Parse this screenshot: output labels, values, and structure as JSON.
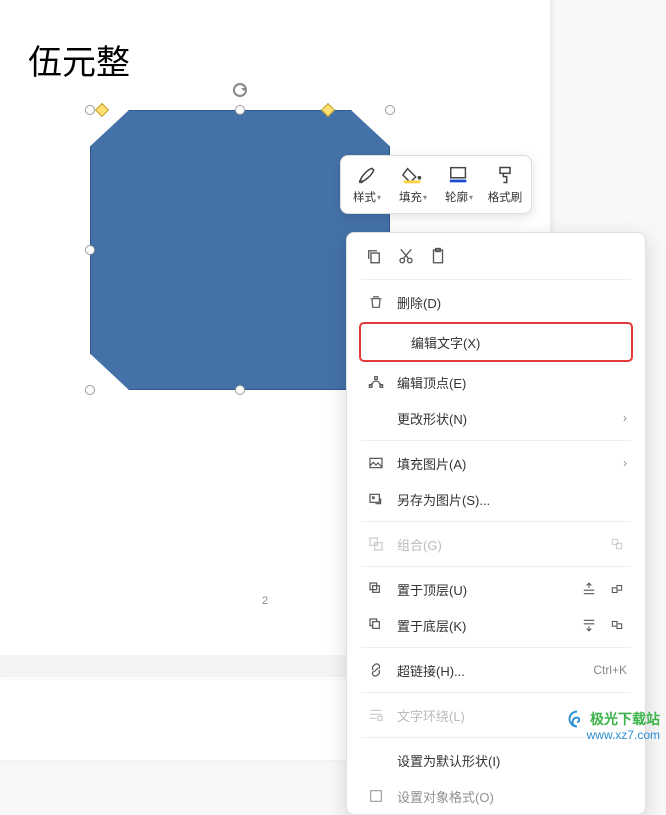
{
  "heading": "伍元整",
  "page_number": "2",
  "mini_toolbar": {
    "style": "样式",
    "fill": "填充",
    "outline": "轮廓",
    "format_painter": "格式刷"
  },
  "ctx": {
    "delete": "删除(D)",
    "edit_text": "编辑文字(X)",
    "edit_points": "编辑顶点(E)",
    "change_shape": "更改形状(N)",
    "fill_picture": "填充图片(A)",
    "save_as_picture": "另存为图片(S)...",
    "group": "组合(G)",
    "bring_front": "置于顶层(U)",
    "send_back": "置于底层(K)",
    "hyperlink": "超链接(H)...",
    "hyperlink_key": "Ctrl+K",
    "text_wrap": "文字环绕(L)",
    "set_default": "设置为默认形状(I)",
    "format_object": "设置对象格式(O)"
  },
  "watermark": {
    "line1": "极光下载站",
    "line2": "www.xz7.com"
  }
}
